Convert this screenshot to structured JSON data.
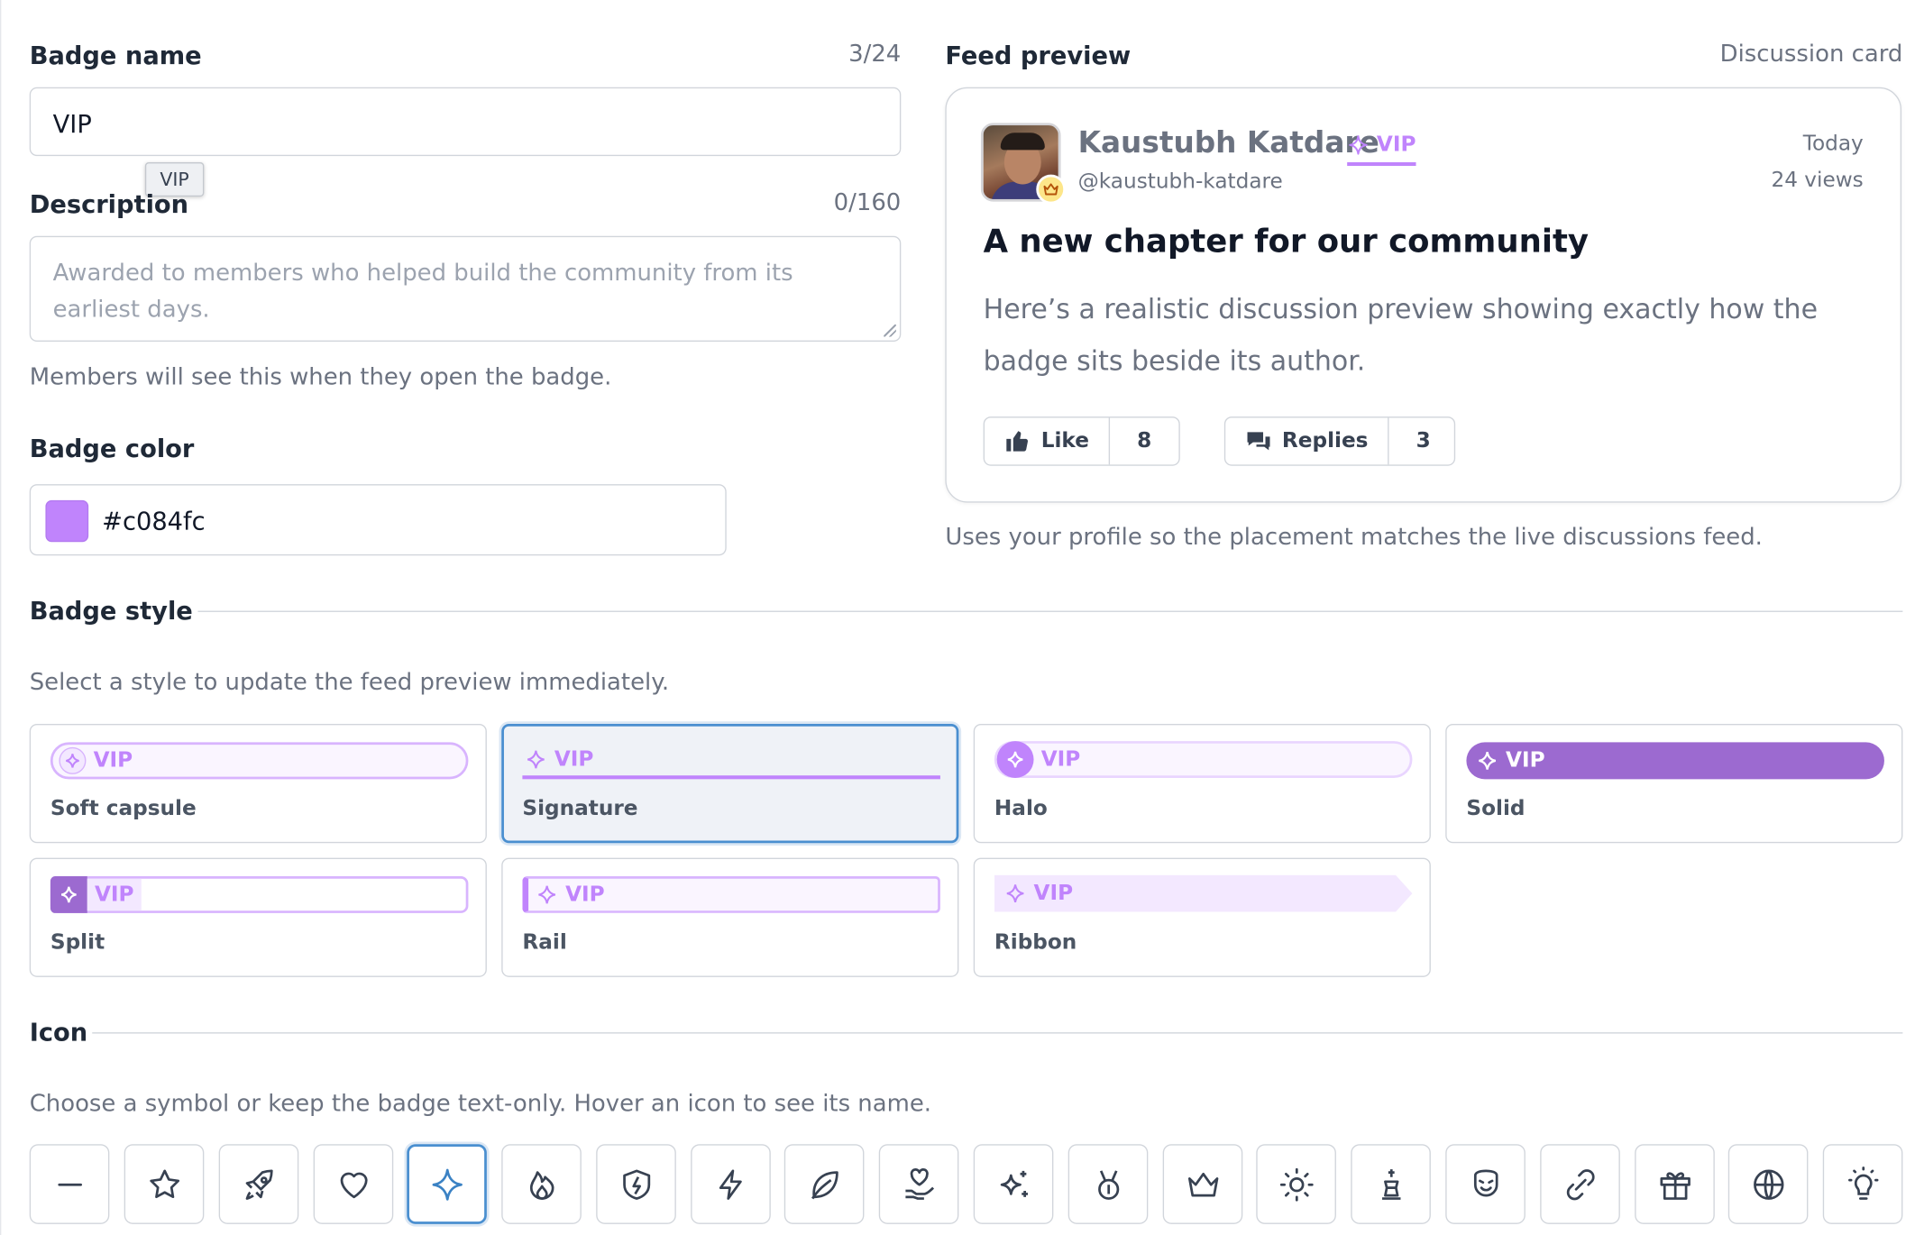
{
  "form": {
    "name_label": "Badge name",
    "name_count": "3/24",
    "name_value": "VIP",
    "tooltip": "VIP",
    "desc_label": "Description",
    "desc_count": "0/160",
    "desc_placeholder": "Awarded to members who helped build the community from its earliest days.",
    "desc_help": "Members will see this when they open the badge.",
    "color_label": "Badge color",
    "color_value": "#c084fc"
  },
  "preview": {
    "label": "Feed preview",
    "type": "Discussion card",
    "author": "Kaustubh Katdare",
    "badge_text": "VIP",
    "handle": "@kaustubh-katdare",
    "date": "Today",
    "views": "24 views",
    "title": "A new chapter for our community",
    "body": "Here’s a realistic discussion preview showing exactly how the badge sits beside its author.",
    "like_label": "Like",
    "like_count": "8",
    "replies_label": "Replies",
    "replies_count": "3",
    "help": "Uses your profile so the placement matches the live discussions feed."
  },
  "style_section": {
    "heading": "Badge style",
    "help": "Select a style to update the feed preview immediately.",
    "badge_text": "VIP",
    "selected": "Signature",
    "styles": [
      "Soft capsule",
      "Signature",
      "Halo",
      "Solid",
      "Split",
      "Rail",
      "Ribbon"
    ]
  },
  "icon_section": {
    "heading": "Icon",
    "help": "Choose a symbol or keep the badge text-only. Hover an icon to see its name.",
    "selected": "sparkle-icon",
    "icons": [
      "none-icon",
      "star-icon",
      "rocket-icon",
      "heart-icon",
      "sparkle-icon",
      "flame-icon",
      "shield-bolt-icon",
      "bolt-icon",
      "leaf-icon",
      "hand-heart-icon",
      "sparkles-icon",
      "medal-icon",
      "crown-icon",
      "sun-icon",
      "chess-king-icon",
      "smile-icon",
      "link-icon",
      "gift-icon",
      "globe-icon",
      "lightbulb-icon"
    ]
  },
  "colors": {
    "accent": "#c084fc",
    "solid": "#9c6ad0",
    "selection": "#4a8fd0"
  }
}
